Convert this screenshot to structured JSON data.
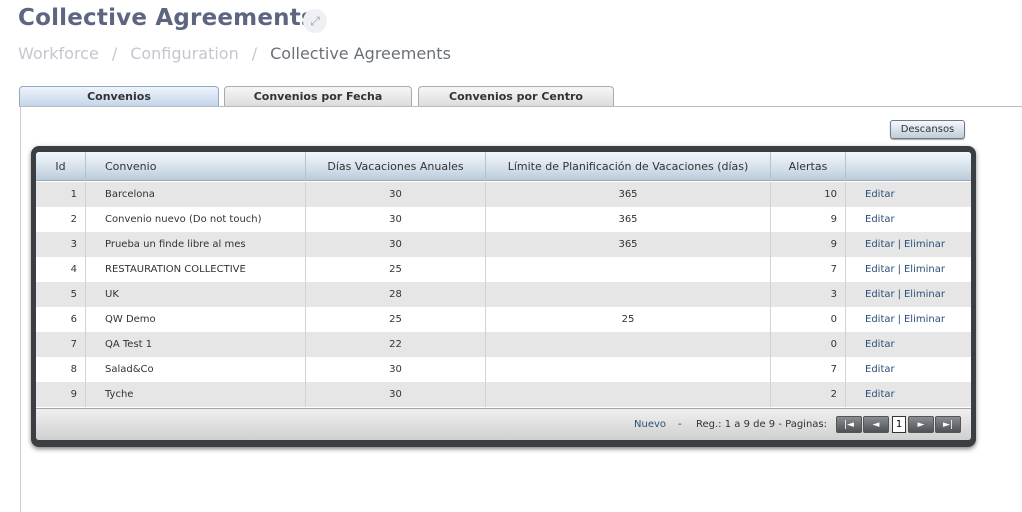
{
  "header": {
    "title": "Collective Agreements",
    "expand_icon": "⤢",
    "breadcrumb": [
      "Workforce",
      "Configuration",
      "Collective Agreements"
    ],
    "breadcrumb_separator": "/"
  },
  "tabs": [
    {
      "label": "Convenios",
      "active": true
    },
    {
      "label": "Convenios por Fecha",
      "active": false
    },
    {
      "label": "Convenios por Centro",
      "active": false
    }
  ],
  "toolbar": {
    "descansos_label": "Descansos"
  },
  "grid": {
    "columns": [
      "Id",
      "Convenio",
      "Días Vacaciones Anuales",
      "Límite de Planificación de Vacaciones (días)",
      "Alertas",
      ""
    ],
    "rows": [
      {
        "id": "1",
        "convenio": "Barcelona",
        "dias": "30",
        "limite": "365",
        "alertas": "10",
        "actions": [
          "Editar"
        ]
      },
      {
        "id": "2",
        "convenio": "Convenio nuevo  (Do not touch)",
        "dias": "30",
        "limite": "365",
        "alertas": "9",
        "actions": [
          "Editar"
        ]
      },
      {
        "id": "3",
        "convenio": "Prueba un finde libre al mes",
        "dias": "30",
        "limite": "365",
        "alertas": "9",
        "actions": [
          "Editar",
          "Eliminar"
        ]
      },
      {
        "id": "4",
        "convenio": "RESTAURATION COLLECTIVE",
        "dias": "25",
        "limite": "",
        "alertas": "7",
        "actions": [
          "Editar",
          "Eliminar"
        ]
      },
      {
        "id": "5",
        "convenio": "UK",
        "dias": "28",
        "limite": "",
        "alertas": "3",
        "actions": [
          "Editar",
          "Eliminar"
        ]
      },
      {
        "id": "6",
        "convenio": "QW Demo",
        "dias": "25",
        "limite": "25",
        "alertas": "0",
        "actions": [
          "Editar",
          "Eliminar"
        ]
      },
      {
        "id": "7",
        "convenio": "QA Test 1",
        "dias": "22",
        "limite": "",
        "alertas": "0",
        "actions": [
          "Editar"
        ]
      },
      {
        "id": "8",
        "convenio": "Salad&Co",
        "dias": "30",
        "limite": "",
        "alertas": "7",
        "actions": [
          "Editar"
        ]
      },
      {
        "id": "9",
        "convenio": "Tyche",
        "dias": "30",
        "limite": "",
        "alertas": "2",
        "actions": [
          "Editar"
        ]
      }
    ],
    "action_separator": "|"
  },
  "footer": {
    "nuevo_label": "Nuevo",
    "dash": "-",
    "records_text": "Reg.: 1 a 9 de 9 - Paginas:",
    "current_page": "1",
    "pager_icons": {
      "first": "|◄",
      "prev": "◄",
      "next": "►",
      "last": "►|"
    }
  }
}
